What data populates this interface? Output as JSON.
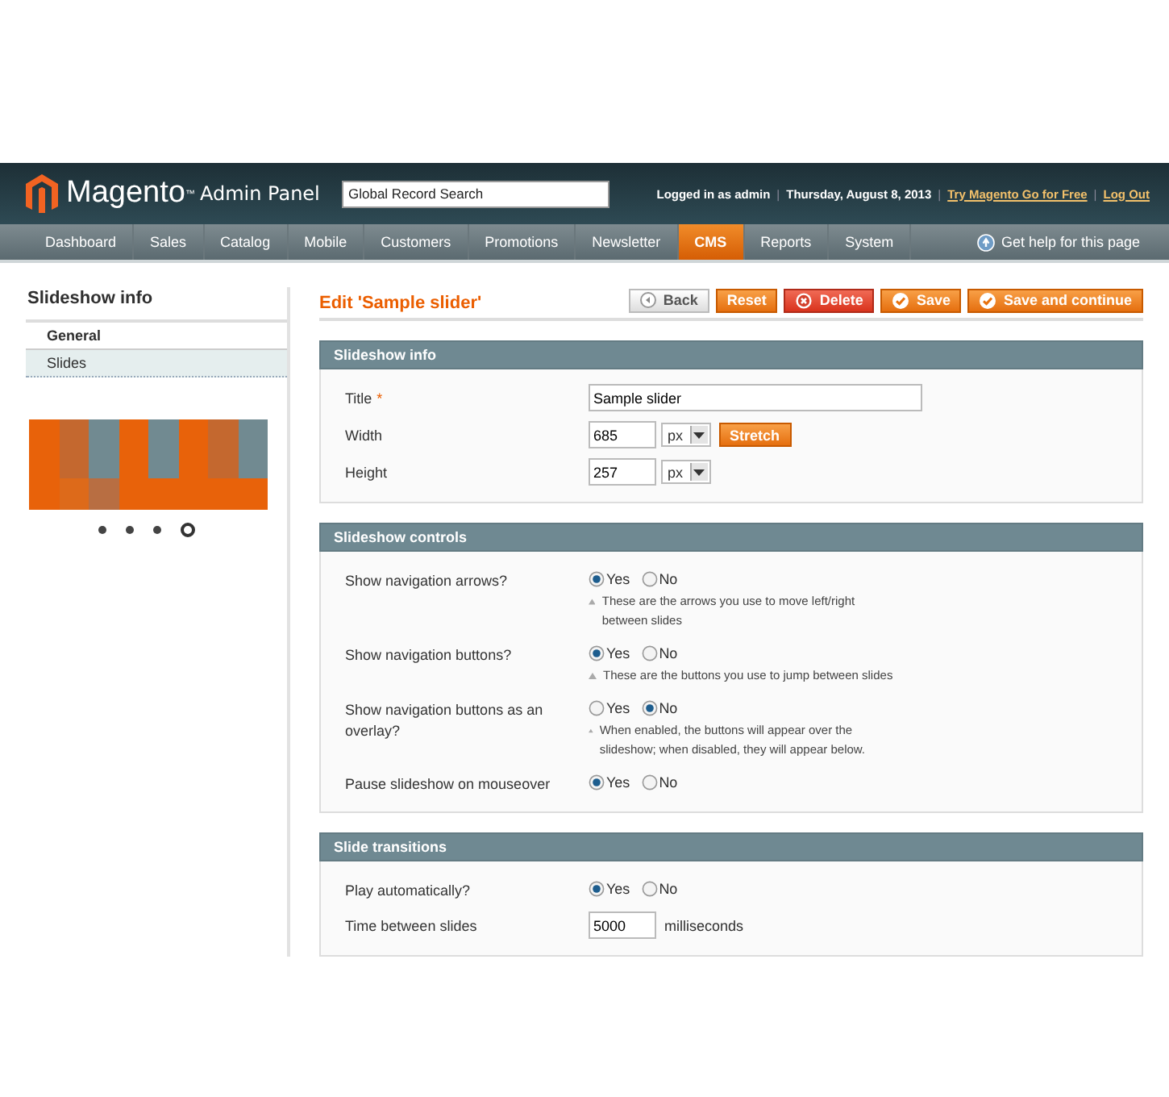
{
  "header": {
    "logo": "Magento",
    "logo_tm": "™",
    "logo_sub": "Admin Panel",
    "search": {
      "placeholder": "Global Record Search"
    },
    "user": "Logged in as admin",
    "separator": "|",
    "date": "Thursday, August 8, 2013",
    "links": [
      "Try Magento Go for Free",
      "Log Out"
    ]
  },
  "nav": {
    "items": [
      {
        "label": "Dashboard",
        "selected": false
      },
      {
        "label": "Sales",
        "selected": false
      },
      {
        "label": "Catalog",
        "selected": false
      },
      {
        "label": "Mobile",
        "selected": false
      },
      {
        "label": "Customers",
        "selected": false
      },
      {
        "label": "Promotions",
        "selected": false
      },
      {
        "label": "Newsletter",
        "selected": false
      },
      {
        "label": "CMS",
        "selected": true
      },
      {
        "label": "Reports",
        "selected": false
      },
      {
        "label": "System",
        "selected": false
      }
    ],
    "help": "Get help for this page"
  },
  "sidebar": {
    "title": "Slideshow info",
    "tabs": [
      {
        "label": "General",
        "selected": true
      },
      {
        "label": "Slides",
        "selected": false
      }
    ],
    "preview_dots": [
      {
        "selected": false
      },
      {
        "selected": false
      },
      {
        "selected": false
      },
      {
        "selected": true
      }
    ]
  },
  "page_title": "Edit 'Sample slider'",
  "buttons": [
    {
      "label": "Back",
      "kind": "back"
    },
    {
      "label": "Reset",
      "kind": "plain"
    },
    {
      "label": "Delete",
      "kind": "delete"
    },
    {
      "label": "Save",
      "kind": "save"
    },
    {
      "label": "Save and continue",
      "kind": "save"
    }
  ],
  "fieldsets": [
    {
      "title": "Slideshow info",
      "rows": [
        {
          "kind": "text",
          "label": "Title",
          "required_mark": "*",
          "value": "Sample slider"
        },
        {
          "kind": "dimension",
          "label": "Width",
          "value": "685",
          "unit": "px",
          "button": "Stretch"
        },
        {
          "kind": "dimension",
          "label": "Height",
          "value": "257",
          "unit": "px"
        }
      ]
    },
    {
      "title": "Slideshow controls",
      "rows": [
        {
          "kind": "radio",
          "label": "Show navigation arrows?",
          "options": [
            {
              "label": "Yes",
              "selected": true
            },
            {
              "label": "No",
              "selected": false
            }
          ],
          "note": "These are the arrows you use to move left/right between slides"
        },
        {
          "kind": "radio",
          "label": "Show navigation buttons?",
          "options": [
            {
              "label": "Yes",
              "selected": true
            },
            {
              "label": "No",
              "selected": false
            }
          ],
          "note": "These are the buttons you use to jump between slides"
        },
        {
          "kind": "radio",
          "label": "Show navigation buttons as an overlay?",
          "options": [
            {
              "label": "Yes",
              "selected": false
            },
            {
              "label": "No",
              "selected": true
            }
          ],
          "note": "When enabled, the buttons will appear over the slideshow; when disabled, they will appear below."
        },
        {
          "kind": "radio",
          "label": "Pause slideshow on mouseover",
          "options": [
            {
              "label": "Yes",
              "selected": true
            },
            {
              "label": "No",
              "selected": false
            }
          ]
        }
      ]
    },
    {
      "title": "Slide transitions",
      "rows": [
        {
          "kind": "radio",
          "label": "Play automatically?",
          "options": [
            {
              "label": "Yes",
              "selected": true
            },
            {
              "label": "No",
              "selected": false
            }
          ]
        },
        {
          "kind": "number",
          "label": "Time between slides",
          "value": "5000",
          "suffix": "milliseconds"
        }
      ]
    }
  ]
}
